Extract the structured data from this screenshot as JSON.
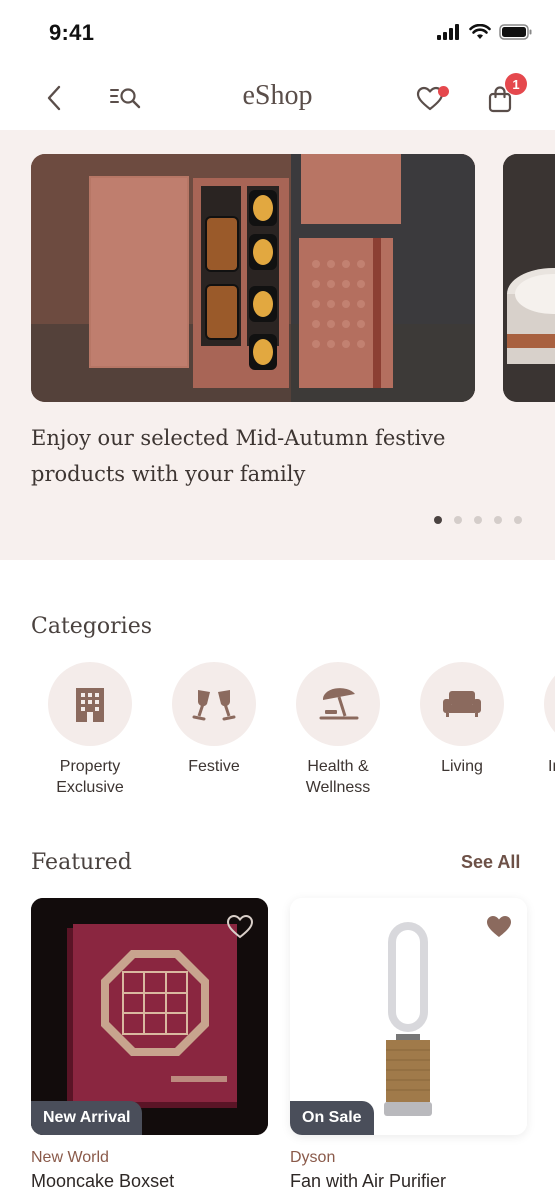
{
  "status_bar": {
    "time": "9:41"
  },
  "nav": {
    "title": "eShop",
    "cart_count": "1"
  },
  "hero": {
    "caption": "Enjoy our selected Mid-Autumn festive products with your family",
    "slide_count": 5,
    "active_slide": 1
  },
  "categories": {
    "title": "Categories",
    "items": [
      {
        "label": "Property Exclusive",
        "icon": "building-icon"
      },
      {
        "label": "Festive",
        "icon": "toast-glasses-icon"
      },
      {
        "label": "Health & Wellness",
        "icon": "beach-umbrella-icon"
      },
      {
        "label": "Living",
        "icon": "sofa-icon"
      },
      {
        "label": "In",
        "icon": "category-icon"
      }
    ]
  },
  "featured": {
    "title": "Featured",
    "see_all": "See All",
    "products": [
      {
        "badge": "New Arrival",
        "brand": "New World",
        "name": "Mooncake Boxset",
        "favorited": false
      },
      {
        "badge": "On Sale",
        "brand": "Dyson",
        "name": "Fan with Air Purifier",
        "favorited": true
      }
    ]
  },
  "colors": {
    "accent": "#8a5a4a",
    "icon_brown": "#8b6a5e",
    "badge_red": "#e5484d",
    "badge_dark": "#4a4e5a",
    "hero_bg": "#f7f0ee"
  }
}
